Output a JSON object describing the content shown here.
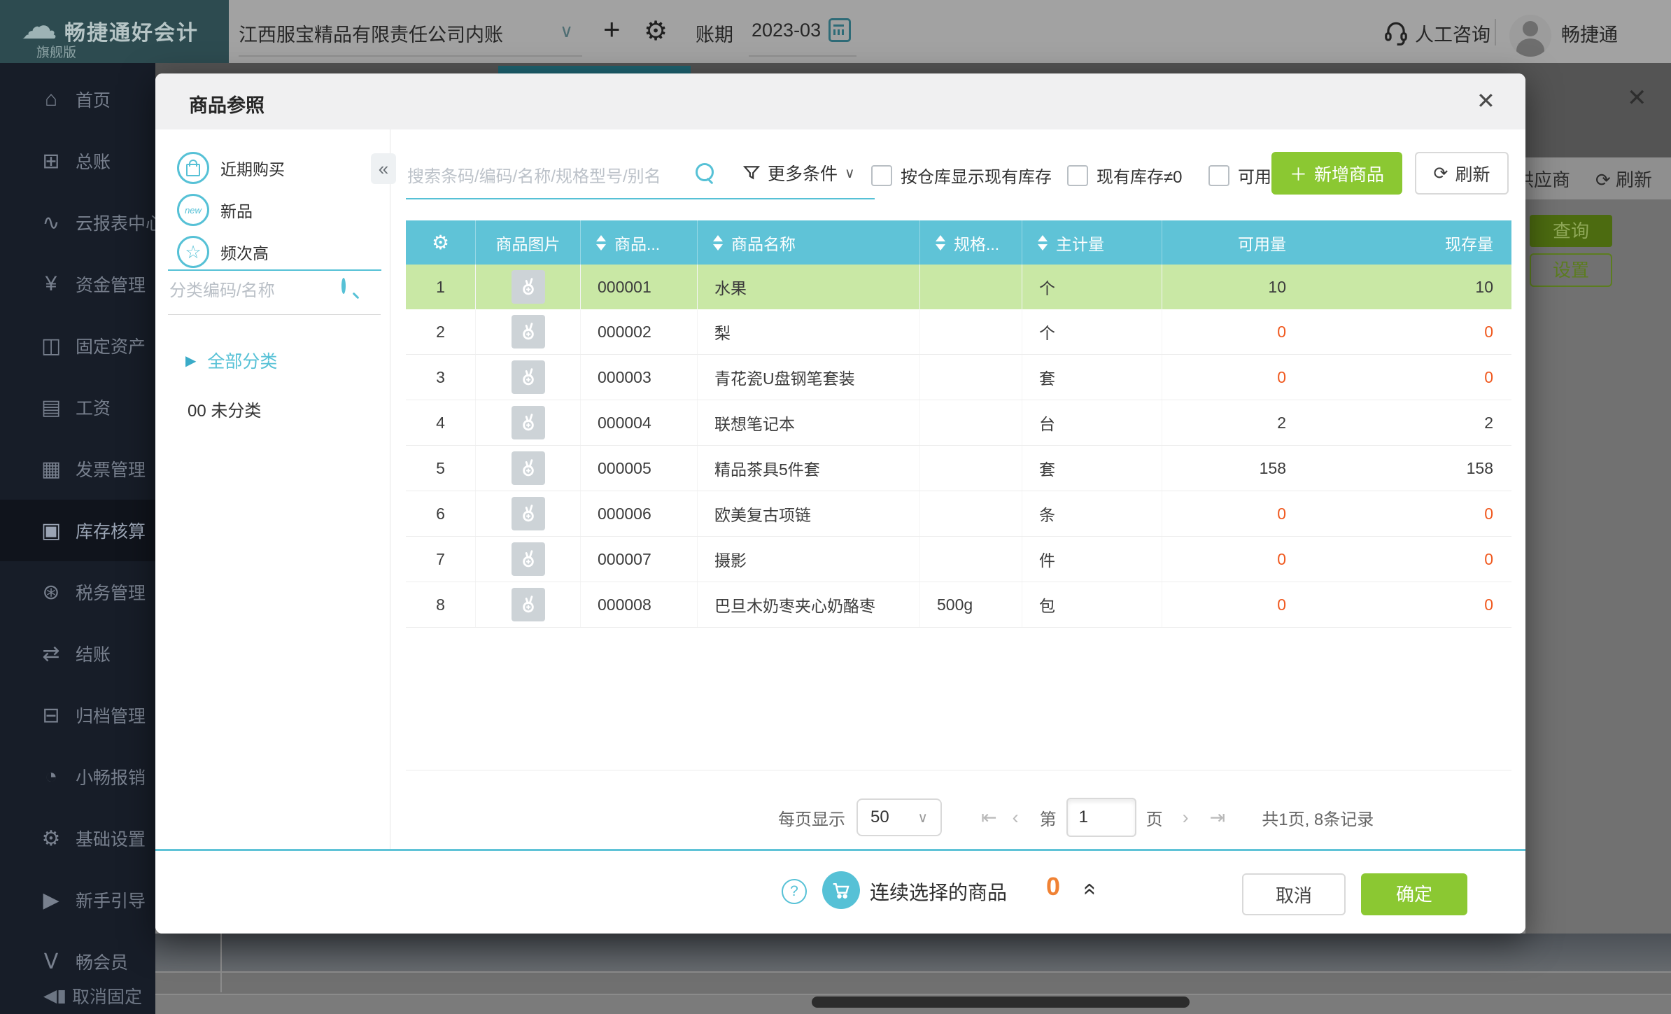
{
  "topbar": {
    "brand": "畅捷通好会计",
    "edition": "旗舰版",
    "company": "江西服宝精品有限责任公司内账",
    "period_label": "账期",
    "period_value": "2023-03",
    "support": "人工咨询",
    "user": "畅捷通"
  },
  "sidebar": {
    "items": [
      {
        "label": "首页",
        "glyph": "⌂",
        "icon": "home-icon",
        "active": false
      },
      {
        "label": "总账",
        "glyph": "⊞",
        "icon": "ledger-icon",
        "active": false
      },
      {
        "label": "云报表中心",
        "glyph": "∿",
        "icon": "cloud-report-icon",
        "active": false
      },
      {
        "label": "资金管理",
        "glyph": "¥",
        "icon": "funds-icon",
        "active": false
      },
      {
        "label": "固定资产",
        "glyph": "◫",
        "icon": "fixed-assets-icon",
        "active": false
      },
      {
        "label": "工资",
        "glyph": "▤",
        "icon": "salary-icon",
        "active": false
      },
      {
        "label": "发票管理",
        "glyph": "▦",
        "icon": "invoice-icon",
        "active": false
      },
      {
        "label": "库存核算",
        "glyph": "▣",
        "icon": "inventory-icon",
        "active": true
      },
      {
        "label": "税务管理",
        "glyph": "⊛",
        "icon": "tax-icon",
        "active": false
      },
      {
        "label": "结账",
        "glyph": "⇄",
        "icon": "closing-icon",
        "active": false
      },
      {
        "label": "归档管理",
        "glyph": "⊟",
        "icon": "archive-icon",
        "active": false
      },
      {
        "label": "小畅报销",
        "glyph": "◔",
        "icon": "reimburse-icon",
        "active": false
      },
      {
        "label": "基础设置",
        "glyph": "⚙",
        "icon": "settings-icon",
        "active": false
      },
      {
        "label": "新手引导",
        "glyph": "▶",
        "icon": "guide-icon",
        "active": false
      },
      {
        "label": "畅会员",
        "glyph": "Ⅴ",
        "icon": "member-icon",
        "active": false
      }
    ],
    "unpin_label": "取消固定"
  },
  "background_page": {
    "supplier_label": "供应商",
    "refresh_label": "刷新",
    "query_button": "查询",
    "settings_button": "设置",
    "close": "✕"
  },
  "modal": {
    "title": "商品参照",
    "close": "✕",
    "left_panel": {
      "quick_filters": [
        {
          "label": "近期购买",
          "icon": "bag-icon"
        },
        {
          "label": "新品",
          "icon": "new-icon",
          "badge": "new"
        },
        {
          "label": "频次高",
          "icon": "star-icon",
          "glyph": "☆"
        }
      ],
      "collapse": "«",
      "search_placeholder": "分类编码/名称",
      "tree_root": "全部分类",
      "tree_item": "00 未分类"
    },
    "toolbar": {
      "search_placeholder": "搜索条码/编码/名称/规格型号/别名",
      "more_filter": "更多条件",
      "cb_warehouse": "按仓库显示现有库存",
      "cb_onhand": "现有库存≠0",
      "cb_available": "可用库",
      "add_button": "新增商品",
      "refresh_button": "刷新"
    },
    "table": {
      "columns": [
        {
          "label": "",
          "icon": "gear-icon",
          "align": "center"
        },
        {
          "label": "商品图片",
          "align": "center"
        },
        {
          "label": "商品...",
          "sortable": true
        },
        {
          "label": "商品名称",
          "sortable": true
        },
        {
          "label": "规格...",
          "sortable": true
        },
        {
          "label": "主计量",
          "sortable": true
        },
        {
          "label": "可用量",
          "align": "right"
        },
        {
          "label": "现存量",
          "align": "right"
        }
      ],
      "rows": [
        {
          "index": "1",
          "code": "000001",
          "name": "水果",
          "spec": "",
          "unit": "个",
          "available": "10",
          "onhand": "10",
          "highlight": true
        },
        {
          "index": "2",
          "code": "000002",
          "name": "梨",
          "spec": "",
          "unit": "个",
          "available": "0",
          "onhand": "0",
          "highlight": false
        },
        {
          "index": "3",
          "code": "000003",
          "name": "青花瓷U盘钢笔套装",
          "spec": "",
          "unit": "套",
          "available": "0",
          "onhand": "0",
          "highlight": false
        },
        {
          "index": "4",
          "code": "000004",
          "name": "联想笔记本",
          "spec": "",
          "unit": "台",
          "available": "2",
          "onhand": "2",
          "highlight": false
        },
        {
          "index": "5",
          "code": "000005",
          "name": "精品茶具5件套",
          "spec": "",
          "unit": "套",
          "available": "158",
          "onhand": "158",
          "highlight": false
        },
        {
          "index": "6",
          "code": "000006",
          "name": "欧美复古项链",
          "spec": "",
          "unit": "条",
          "available": "0",
          "onhand": "0",
          "highlight": false
        },
        {
          "index": "7",
          "code": "000007",
          "name": "摄影",
          "spec": "",
          "unit": "件",
          "available": "0",
          "onhand": "0",
          "highlight": false
        },
        {
          "index": "8",
          "code": "000008",
          "name": "巴旦木奶枣夹心奶酪枣",
          "spec": "500g",
          "unit": "包",
          "available": "0",
          "onhand": "0",
          "highlight": false
        }
      ]
    },
    "pagination": {
      "per_page_label": "每页显示",
      "per_page_value": "50",
      "first": "⇤",
      "prev": "‹",
      "next": "›",
      "last": "⇥",
      "page_prefix": "第",
      "page_value": "1",
      "page_suffix": "页",
      "summary": "共1页, 8条记录"
    },
    "footer": {
      "help": "?",
      "selected_label": "连续选择的商品",
      "selected_count": "0",
      "cancel_button": "取消",
      "confirm_button": "确定"
    }
  },
  "colors": {
    "teal_accent": "#56c1d6",
    "table_header": "#5fc3d7",
    "row_highlight": "#c9e8a5",
    "green_button": "#8bc832",
    "orange_zero": "#f0591f",
    "sidebar_bg": "#171d28",
    "logo_bg": "#2d4b50"
  }
}
